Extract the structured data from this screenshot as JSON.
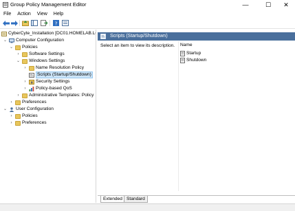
{
  "window": {
    "title": "Group Policy Management Editor",
    "controls": {
      "minimize": "—",
      "maximize": "☐",
      "close": "✕"
    }
  },
  "menu": [
    "File",
    "Action",
    "View",
    "Help"
  ],
  "toolbar": [
    "back-arrow-icon",
    "forward-arrow-icon",
    "up-folder-icon",
    "show-hide-tree-icon",
    "export-list-icon",
    "help-icon",
    "properties-icon"
  ],
  "tree": {
    "root": "CyberCyte_Installation [DC01.HOMELAB.LO",
    "computer_configuration": "Computer Configuration",
    "policies": "Policies",
    "software_settings": "Software Settings",
    "windows_settings": "Windows Settings",
    "name_resolution_policy": "Name Resolution Policy",
    "scripts": "Scripts (Startup/Shutdown)",
    "security_settings": "Security Settings",
    "policy_based_qos": "Policy-based QoS",
    "administrative_templates": "Administrative Templates: Policy",
    "preferences": "Preferences",
    "user_configuration": "User Configuration",
    "user_policies": "Policies",
    "user_preferences": "Preferences"
  },
  "details": {
    "header_title": "Scripts (Startup/Shutdown)",
    "description": "Select an item to view its description.",
    "column_name": "Name",
    "items": [
      "Startup",
      "Shutdown"
    ]
  },
  "tabs": [
    "Extended",
    "Standard"
  ]
}
